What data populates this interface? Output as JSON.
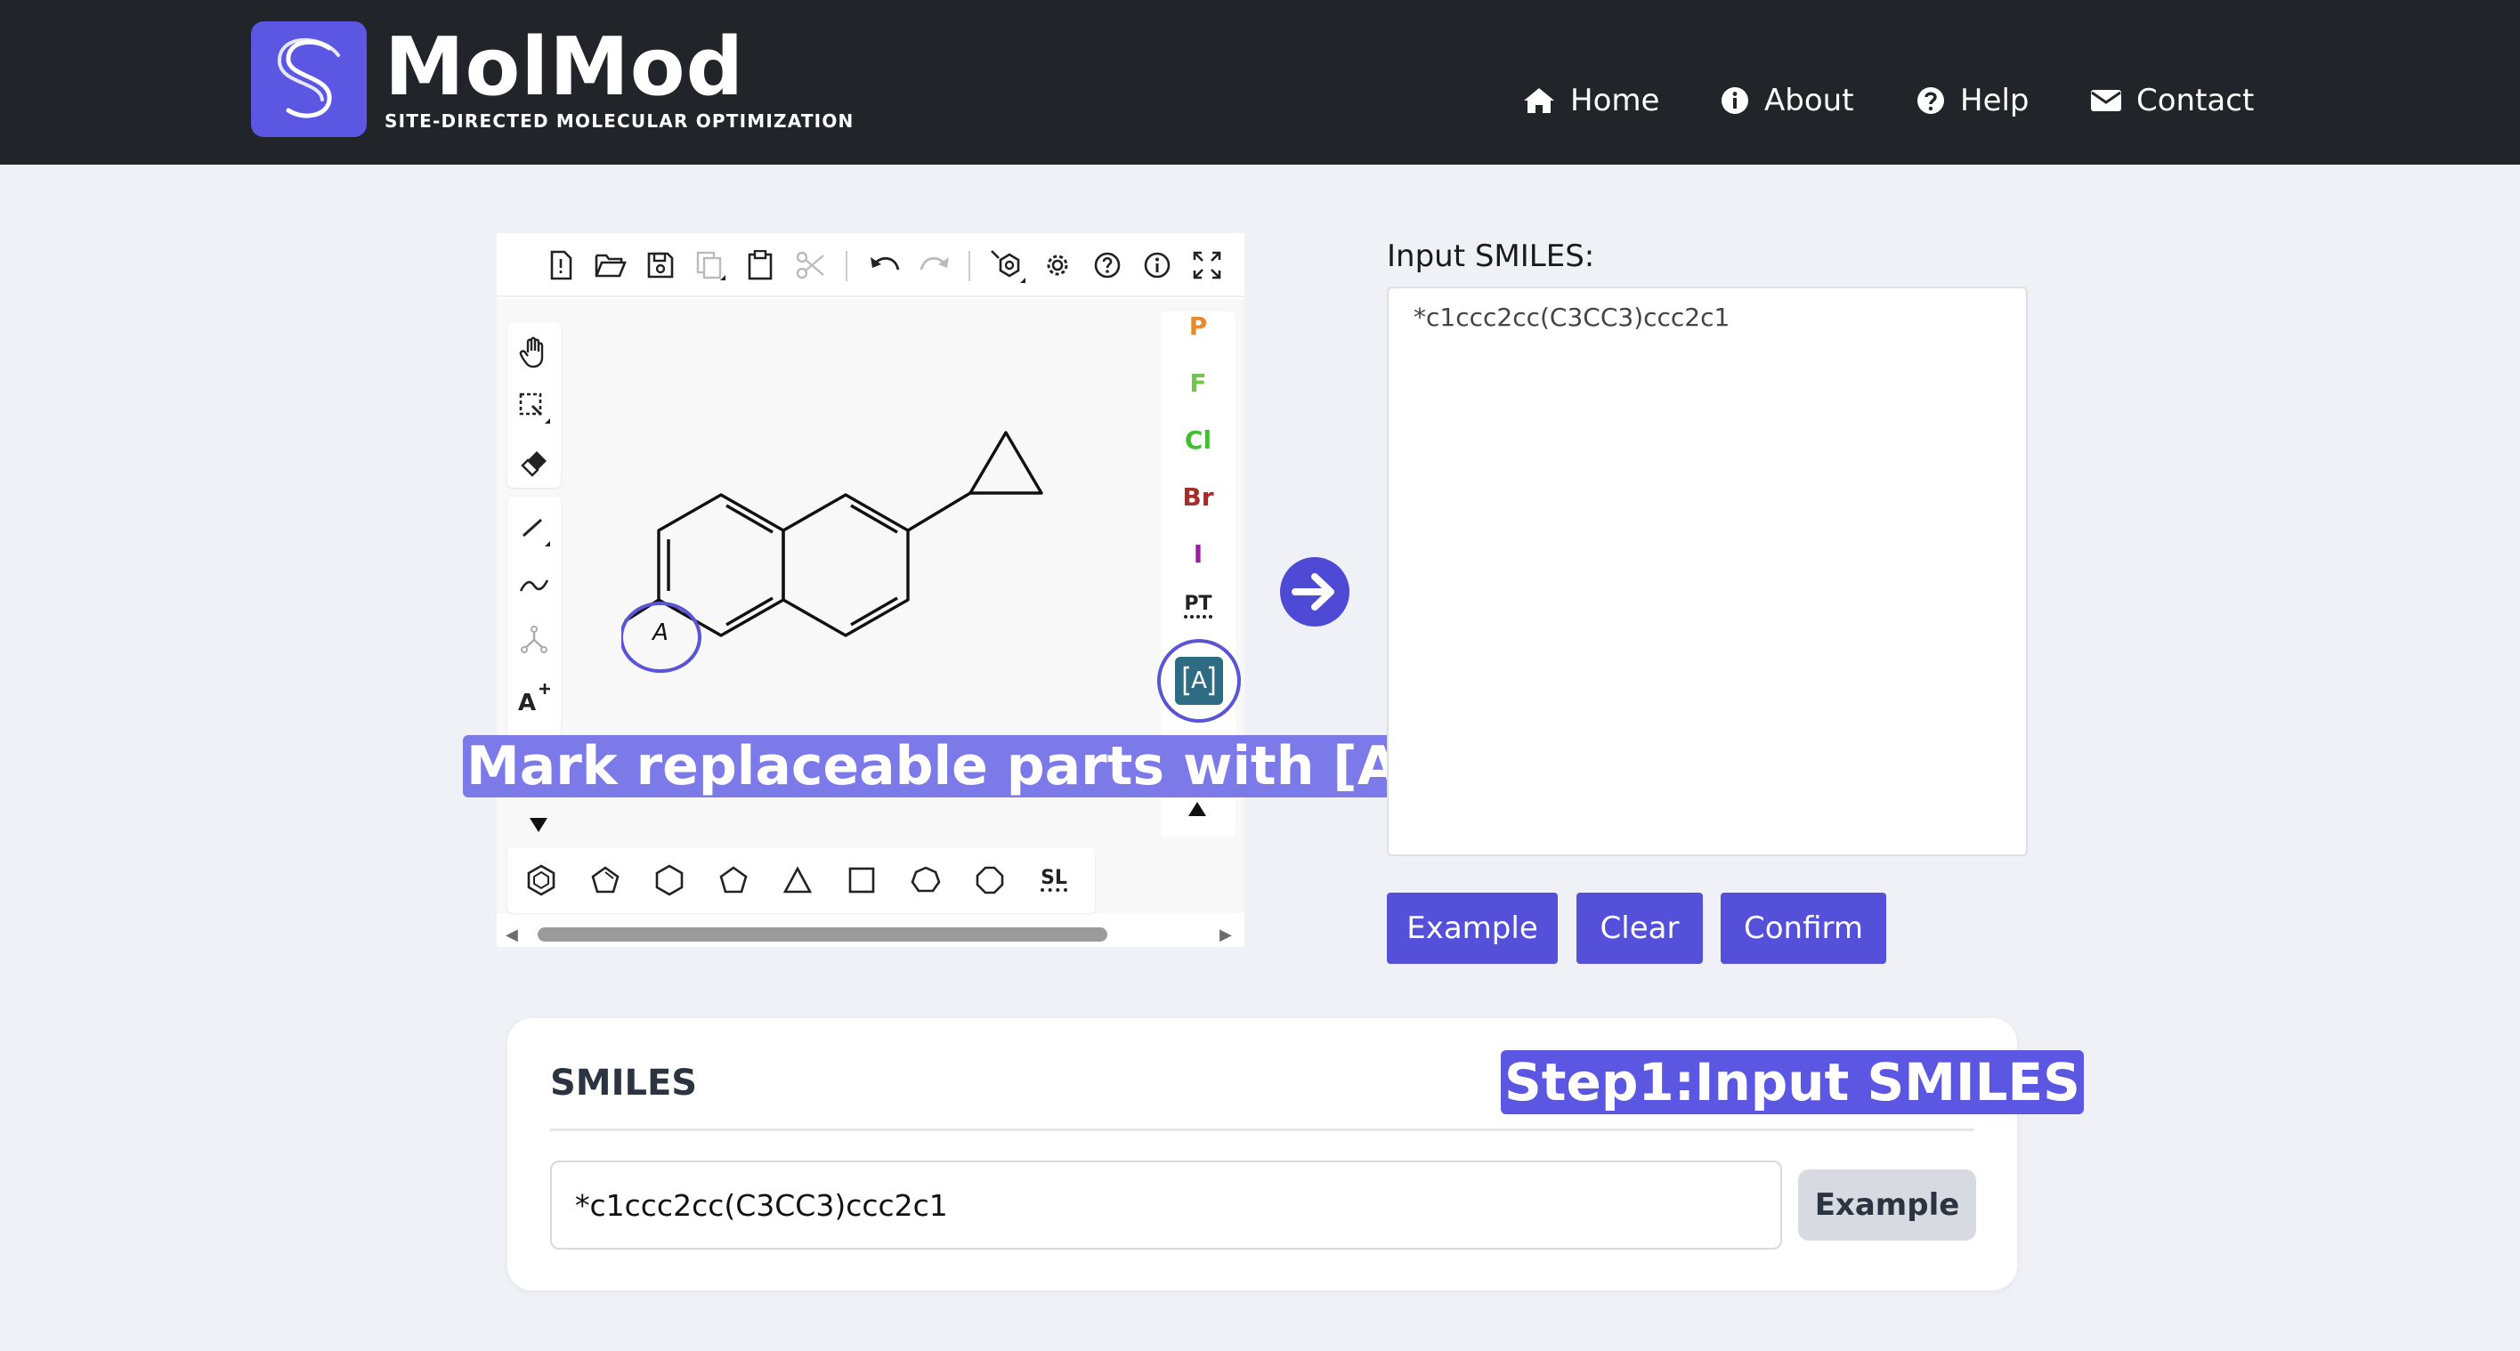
{
  "brand": {
    "title": "MolMod",
    "subtitle": "SITE-DIRECTED MOLECULAR OPTIMIZATION"
  },
  "nav": [
    {
      "label": "Home",
      "icon": "home-icon"
    },
    {
      "label": "About",
      "icon": "info-icon"
    },
    {
      "label": "Help",
      "icon": "question-icon"
    },
    {
      "label": "Contact",
      "icon": "envelope-icon"
    }
  ],
  "editor": {
    "top_toolbar_icons": [
      "new-file-icon",
      "open-folder-icon",
      "save-icon",
      "copy-icon",
      "paste-icon",
      "cut-icon",
      "undo-icon",
      "redo-icon",
      "aromatize-icon",
      "settings-icon",
      "help-icon",
      "info-icon",
      "fullscreen-icon"
    ],
    "left_toolbar_icons": [
      "hand-icon",
      "select-icon",
      "eraser-icon",
      "bond-icon",
      "chain-icon",
      "template-icon",
      "charge-icon"
    ],
    "elements": [
      {
        "symbol": "P",
        "color": "#e8892c"
      },
      {
        "symbol": "F",
        "color": "#74c44a"
      },
      {
        "symbol": "Cl",
        "color": "#3fbf2f"
      },
      {
        "symbol": "Br",
        "color": "#a22d2a"
      },
      {
        "symbol": "I",
        "color": "#9b1da3"
      },
      {
        "symbol": "PT",
        "color": "#222222"
      }
    ],
    "rgroup_label": "A",
    "rgroup_button_label": "A",
    "bottom_toolbar_icons": [
      "benzene-icon",
      "cyclopentadiene-icon",
      "cyclohexane-icon",
      "cyclopentane-icon",
      "cyclopropane-icon",
      "cyclobutane-icon",
      "cycloheptane-icon",
      "cyclooctane-icon",
      "structure-library-icon"
    ],
    "structure_library_label": "SL",
    "annotation": "Mark replaceable parts with [A]"
  },
  "input_panel": {
    "label": "Input SMILES:",
    "value": "*c1ccc2cc(C3CC3)ccc2c1",
    "buttons": {
      "example": "Example",
      "clear": "Clear",
      "confirm": "Confirm"
    }
  },
  "smiles_card": {
    "title": "SMILES",
    "step_label": "Step1:Input SMILES",
    "input_value": "*c1ccc2cc(C3CC3)ccc2c1",
    "example_button": "Example"
  },
  "colors": {
    "accent": "#5450d9",
    "navbar": "#212529",
    "background": "#f0f1f6"
  }
}
